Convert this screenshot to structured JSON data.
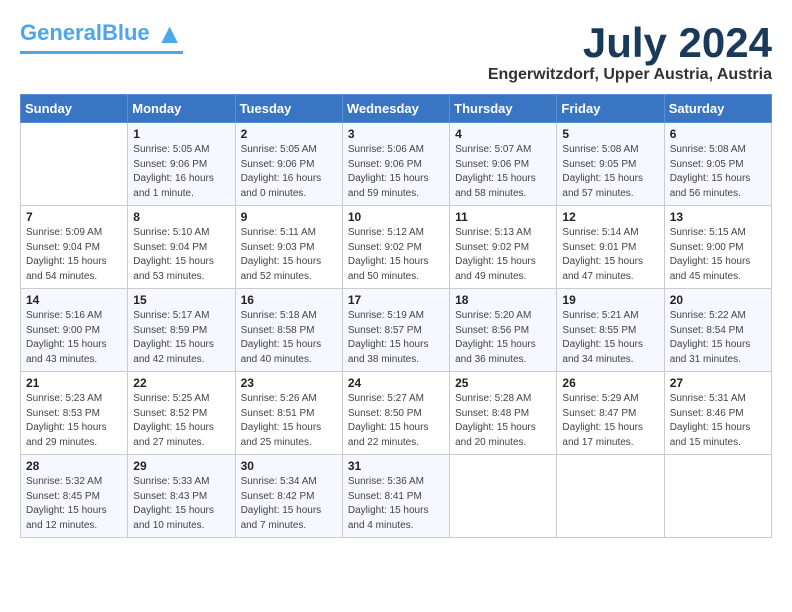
{
  "header": {
    "logo_general": "General",
    "logo_blue": "Blue",
    "month_title": "July 2024",
    "location": "Engerwitzdorf, Upper Austria, Austria"
  },
  "days_of_week": [
    "Sunday",
    "Monday",
    "Tuesday",
    "Wednesday",
    "Thursday",
    "Friday",
    "Saturday"
  ],
  "weeks": [
    [
      {
        "day": "",
        "content": ""
      },
      {
        "day": "1",
        "content": "Sunrise: 5:05 AM\nSunset: 9:06 PM\nDaylight: 16 hours\nand 1 minute."
      },
      {
        "day": "2",
        "content": "Sunrise: 5:05 AM\nSunset: 9:06 PM\nDaylight: 16 hours\nand 0 minutes."
      },
      {
        "day": "3",
        "content": "Sunrise: 5:06 AM\nSunset: 9:06 PM\nDaylight: 15 hours\nand 59 minutes."
      },
      {
        "day": "4",
        "content": "Sunrise: 5:07 AM\nSunset: 9:06 PM\nDaylight: 15 hours\nand 58 minutes."
      },
      {
        "day": "5",
        "content": "Sunrise: 5:08 AM\nSunset: 9:05 PM\nDaylight: 15 hours\nand 57 minutes."
      },
      {
        "day": "6",
        "content": "Sunrise: 5:08 AM\nSunset: 9:05 PM\nDaylight: 15 hours\nand 56 minutes."
      }
    ],
    [
      {
        "day": "7",
        "content": "Sunrise: 5:09 AM\nSunset: 9:04 PM\nDaylight: 15 hours\nand 54 minutes."
      },
      {
        "day": "8",
        "content": "Sunrise: 5:10 AM\nSunset: 9:04 PM\nDaylight: 15 hours\nand 53 minutes."
      },
      {
        "day": "9",
        "content": "Sunrise: 5:11 AM\nSunset: 9:03 PM\nDaylight: 15 hours\nand 52 minutes."
      },
      {
        "day": "10",
        "content": "Sunrise: 5:12 AM\nSunset: 9:02 PM\nDaylight: 15 hours\nand 50 minutes."
      },
      {
        "day": "11",
        "content": "Sunrise: 5:13 AM\nSunset: 9:02 PM\nDaylight: 15 hours\nand 49 minutes."
      },
      {
        "day": "12",
        "content": "Sunrise: 5:14 AM\nSunset: 9:01 PM\nDaylight: 15 hours\nand 47 minutes."
      },
      {
        "day": "13",
        "content": "Sunrise: 5:15 AM\nSunset: 9:00 PM\nDaylight: 15 hours\nand 45 minutes."
      }
    ],
    [
      {
        "day": "14",
        "content": "Sunrise: 5:16 AM\nSunset: 9:00 PM\nDaylight: 15 hours\nand 43 minutes."
      },
      {
        "day": "15",
        "content": "Sunrise: 5:17 AM\nSunset: 8:59 PM\nDaylight: 15 hours\nand 42 minutes."
      },
      {
        "day": "16",
        "content": "Sunrise: 5:18 AM\nSunset: 8:58 PM\nDaylight: 15 hours\nand 40 minutes."
      },
      {
        "day": "17",
        "content": "Sunrise: 5:19 AM\nSunset: 8:57 PM\nDaylight: 15 hours\nand 38 minutes."
      },
      {
        "day": "18",
        "content": "Sunrise: 5:20 AM\nSunset: 8:56 PM\nDaylight: 15 hours\nand 36 minutes."
      },
      {
        "day": "19",
        "content": "Sunrise: 5:21 AM\nSunset: 8:55 PM\nDaylight: 15 hours\nand 34 minutes."
      },
      {
        "day": "20",
        "content": "Sunrise: 5:22 AM\nSunset: 8:54 PM\nDaylight: 15 hours\nand 31 minutes."
      }
    ],
    [
      {
        "day": "21",
        "content": "Sunrise: 5:23 AM\nSunset: 8:53 PM\nDaylight: 15 hours\nand 29 minutes."
      },
      {
        "day": "22",
        "content": "Sunrise: 5:25 AM\nSunset: 8:52 PM\nDaylight: 15 hours\nand 27 minutes."
      },
      {
        "day": "23",
        "content": "Sunrise: 5:26 AM\nSunset: 8:51 PM\nDaylight: 15 hours\nand 25 minutes."
      },
      {
        "day": "24",
        "content": "Sunrise: 5:27 AM\nSunset: 8:50 PM\nDaylight: 15 hours\nand 22 minutes."
      },
      {
        "day": "25",
        "content": "Sunrise: 5:28 AM\nSunset: 8:48 PM\nDaylight: 15 hours\nand 20 minutes."
      },
      {
        "day": "26",
        "content": "Sunrise: 5:29 AM\nSunset: 8:47 PM\nDaylight: 15 hours\nand 17 minutes."
      },
      {
        "day": "27",
        "content": "Sunrise: 5:31 AM\nSunset: 8:46 PM\nDaylight: 15 hours\nand 15 minutes."
      }
    ],
    [
      {
        "day": "28",
        "content": "Sunrise: 5:32 AM\nSunset: 8:45 PM\nDaylight: 15 hours\nand 12 minutes."
      },
      {
        "day": "29",
        "content": "Sunrise: 5:33 AM\nSunset: 8:43 PM\nDaylight: 15 hours\nand 10 minutes."
      },
      {
        "day": "30",
        "content": "Sunrise: 5:34 AM\nSunset: 8:42 PM\nDaylight: 15 hours\nand 7 minutes."
      },
      {
        "day": "31",
        "content": "Sunrise: 5:36 AM\nSunset: 8:41 PM\nDaylight: 15 hours\nand 4 minutes."
      },
      {
        "day": "",
        "content": ""
      },
      {
        "day": "",
        "content": ""
      },
      {
        "day": "",
        "content": ""
      }
    ]
  ]
}
